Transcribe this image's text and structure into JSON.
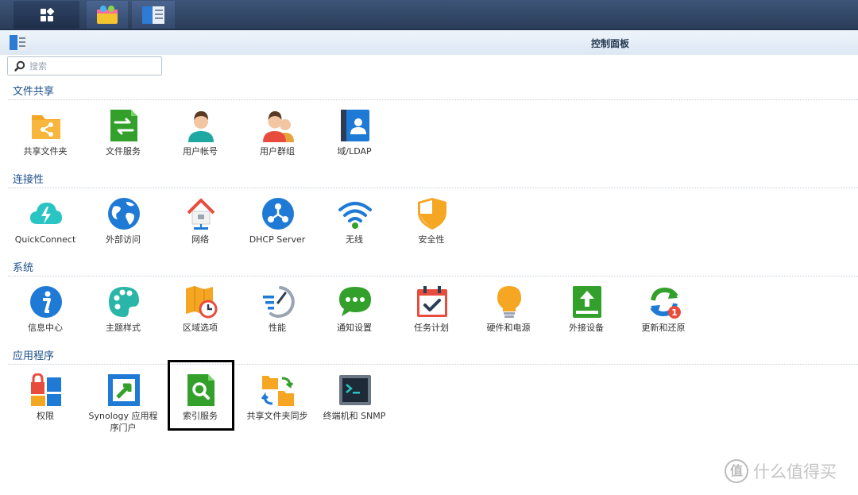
{
  "window": {
    "title": "控制面板"
  },
  "search": {
    "placeholder": "搜索"
  },
  "sections": [
    {
      "title": "文件共享",
      "items": [
        "共享文件夹",
        "文件服务",
        "用户帐号",
        "用户群组",
        "域/LDAP"
      ]
    },
    {
      "title": "连接性",
      "items": [
        "QuickConnect",
        "外部访问",
        "网络",
        "DHCP Server",
        "无线",
        "安全性"
      ]
    },
    {
      "title": "系统",
      "items": [
        "信息中心",
        "主题样式",
        "区域选项",
        "性能",
        "通知设置",
        "任务计划",
        "硬件和电源",
        "外接设备",
        "更新和还原"
      ]
    },
    {
      "title": "应用程序",
      "items": [
        "权限",
        "Synology 应用程序门户",
        "索引服务",
        "共享文件夹同步",
        "终端机和 SNMP"
      ]
    }
  ],
  "badges": {
    "update_count": "1"
  },
  "watermark": {
    "logo": "值",
    "text": "什么值得买"
  },
  "colors": {
    "accent": "#1b4f8a",
    "green": "#33a02c",
    "blue": "#1f7ad6",
    "orange": "#f5a623"
  }
}
